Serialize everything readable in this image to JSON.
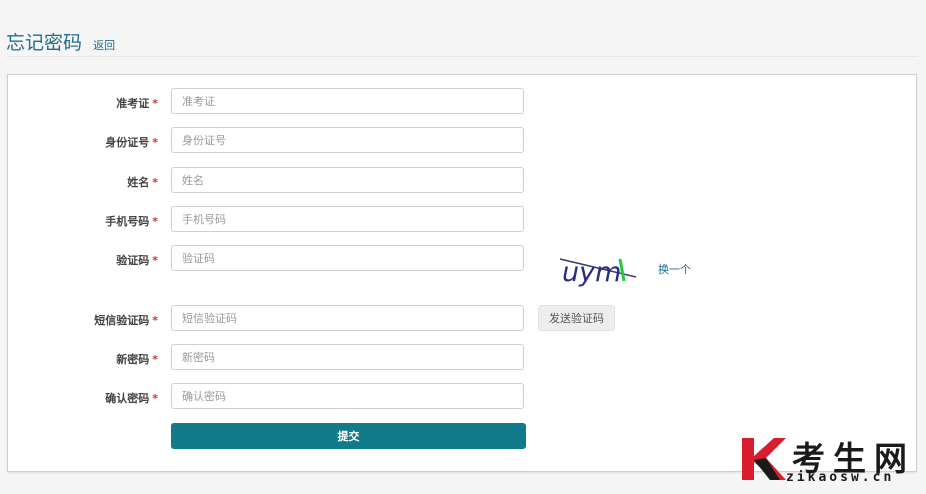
{
  "header": {
    "title": "忘记密码",
    "back_link": "返回"
  },
  "form": {
    "fields": [
      {
        "label": "准考证",
        "placeholder": "准考证",
        "required_mark": "*"
      },
      {
        "label": "身份证号",
        "placeholder": "身份证号",
        "required_mark": "*"
      },
      {
        "label": "姓名",
        "placeholder": "姓名",
        "required_mark": "*"
      },
      {
        "label": "手机号码",
        "placeholder": "手机号码",
        "required_mark": "*"
      },
      {
        "label": "验证码",
        "placeholder": "验证码",
        "required_mark": "*"
      },
      {
        "label": "短信验证码",
        "placeholder": "短信验证码",
        "required_mark": "*"
      },
      {
        "label": "新密码",
        "placeholder": "新密码",
        "required_mark": "*"
      },
      {
        "label": "确认密码",
        "placeholder": "确认密码",
        "required_mark": "*"
      }
    ],
    "captcha_text": "uym",
    "captcha_refresh": "换一个",
    "send_sms_button": "发送验证码",
    "submit_button": "提交"
  },
  "watermark": {
    "text": "考生网",
    "url": "zikaosw.cn",
    "logo_letter": "K"
  },
  "colors": {
    "accent": "#117a8b",
    "link": "#1f6e8c",
    "required": "#d9302c"
  }
}
